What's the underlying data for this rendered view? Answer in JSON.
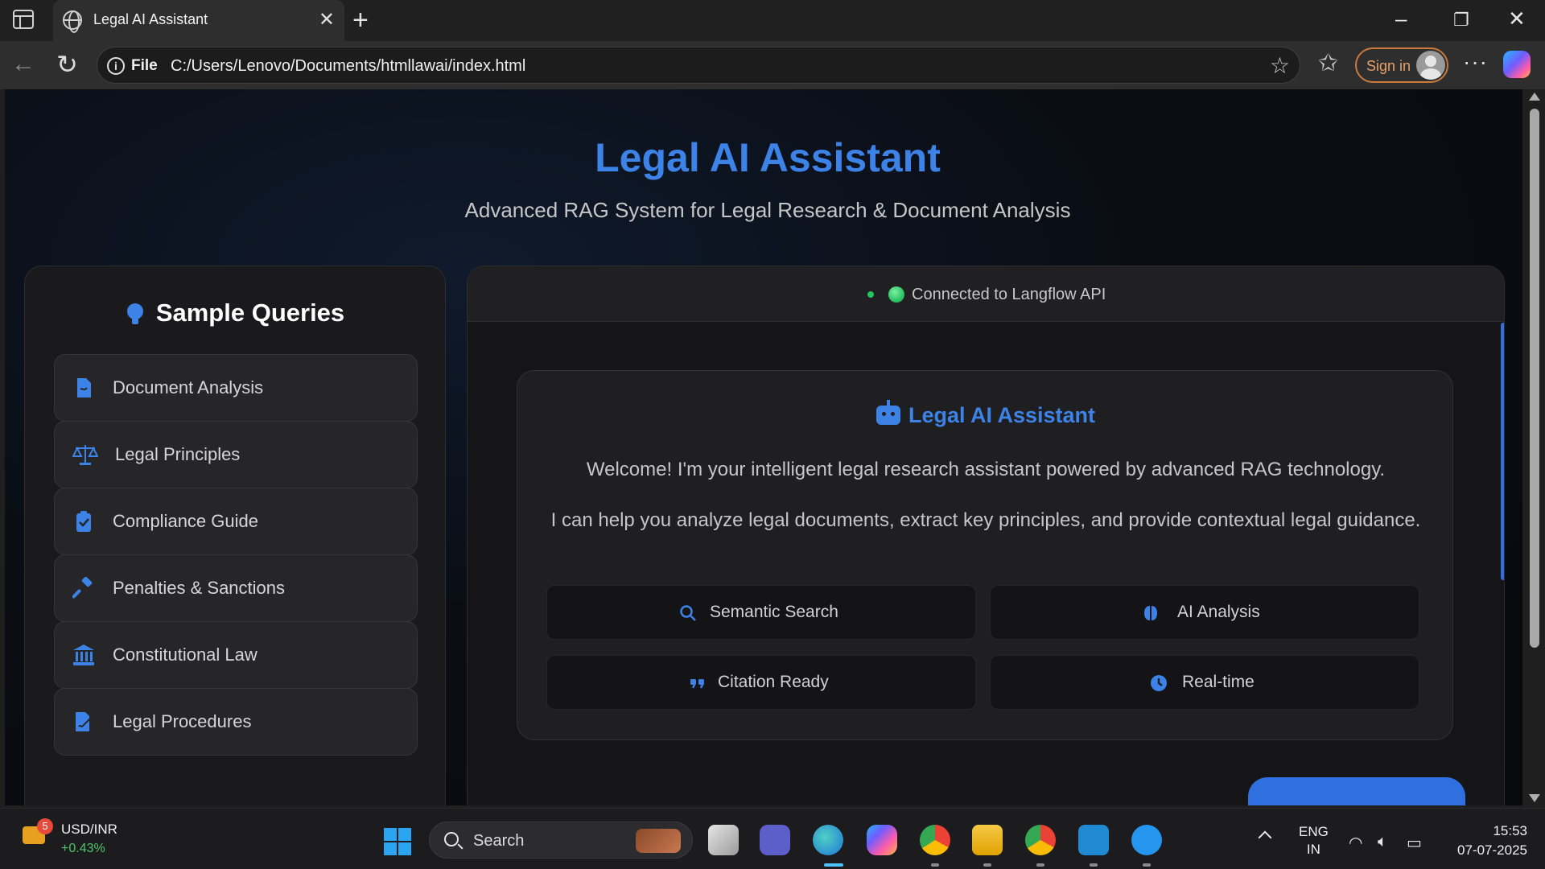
{
  "browser": {
    "tab_title": "Legal AI Assistant",
    "address_label": "File",
    "url": "C:/Users/Lenovo/Documents/htmllawai/index.html",
    "sign_in": "Sign in"
  },
  "page": {
    "title": "Legal AI Assistant",
    "subtitle": "Advanced RAG System for Legal Research & Document Analysis"
  },
  "sidebar": {
    "heading": "Sample Queries",
    "items": [
      {
        "label": "Document Analysis",
        "icon": "document-icon"
      },
      {
        "label": "Legal Principles",
        "icon": "scales-icon"
      },
      {
        "label": "Compliance Guide",
        "icon": "clipboard-check-icon"
      },
      {
        "label": "Penalties & Sanctions",
        "icon": "gavel-icon"
      },
      {
        "label": "Constitutional Law",
        "icon": "landmark-icon"
      },
      {
        "label": "Legal Procedures",
        "icon": "file-signature-icon"
      }
    ]
  },
  "chat": {
    "status": "Connected to Langflow API",
    "welcome": {
      "title": "Legal AI Assistant",
      "line1": "Welcome! I'm your intelligent legal research assistant powered by advanced RAG technology.",
      "line2": "I can help you analyze legal documents, extract key principles, and provide contextual legal guidance.",
      "features": [
        {
          "label": "Semantic Search",
          "icon": "search-icon"
        },
        {
          "label": "AI Analysis",
          "icon": "brain-icon"
        },
        {
          "label": "Citation Ready",
          "icon": "quote-icon"
        },
        {
          "label": "Real-time",
          "icon": "clock-icon"
        }
      ]
    }
  },
  "taskbar": {
    "widget_badge": "5",
    "widget_name": "USD/INR",
    "widget_change": "+0.43%",
    "search_label": "Search",
    "lang_line1": "ENG",
    "lang_line2": "IN",
    "time": "15:53",
    "date": "07-07-2025"
  },
  "colors": {
    "accent": "#3d82e6",
    "status_green": "#22c55e",
    "background": "#0a0d14"
  }
}
